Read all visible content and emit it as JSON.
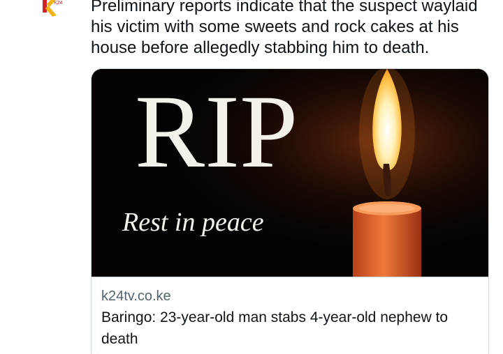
{
  "avatar": {
    "icon": "k24-logo-icon",
    "colors": {
      "yellow": "#f2b418",
      "red": "#d2232a"
    },
    "small_text": "K24"
  },
  "tweet": {
    "text": "Preliminary reports indicate that the suspect waylaid his victim with some sweets and rock cakes at his house before allegedly stabbing him to death."
  },
  "card": {
    "image": {
      "headline": "RIP",
      "subtitle": "Rest in peace",
      "icon": "candle-icon",
      "colors": {
        "background": "#050302",
        "candle": "#e8622a",
        "flame": "#ffd36a"
      }
    },
    "domain": "k24tv.co.ke",
    "title": "Baringo: 23-year-old man stabs 4-year-old nephew to death"
  }
}
